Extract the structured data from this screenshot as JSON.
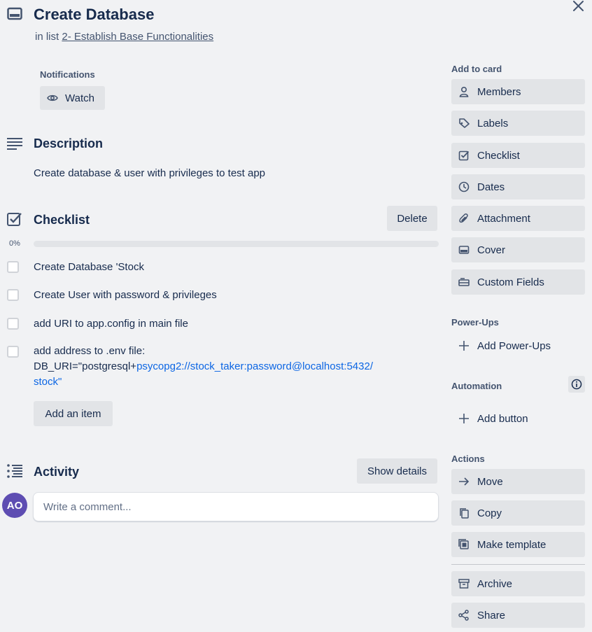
{
  "card": {
    "title": "Create Database",
    "in_list_prefix": "in list",
    "list_name": "2- Establish Base Functionalities"
  },
  "notifications": {
    "label": "Notifications",
    "watch_label": "Watch"
  },
  "description": {
    "heading": "Description",
    "text": "Create database & user with privileges to test app"
  },
  "checklist": {
    "heading": "Checklist",
    "delete_label": "Delete",
    "progress_percent": 0,
    "progress_label": "0%",
    "items": [
      {
        "text": "Create Database 'Stock",
        "checked": false
      },
      {
        "text": "Create User with password & privileges",
        "checked": false
      },
      {
        "text": "add URI to app.config in main file",
        "checked": false
      },
      {
        "text_line1": "add address to .env file:",
        "text_prefix": "DB_URI=\"postgresql+",
        "text_link": "psycopg2://stock_taker:password@localhost:5432/stock",
        "text_suffix": "\"",
        "checked": false
      }
    ],
    "add_item_label": "Add an item"
  },
  "activity": {
    "heading": "Activity",
    "show_details_label": "Show details",
    "avatar_initials": "AO",
    "comment_placeholder": "Write a comment..."
  },
  "sidebar": {
    "add_to_card_label": "Add to card",
    "add_to_card": [
      {
        "label": "Members",
        "icon": "person-icon"
      },
      {
        "label": "Labels",
        "icon": "tag-icon"
      },
      {
        "label": "Checklist",
        "icon": "checkbox-icon"
      },
      {
        "label": "Dates",
        "icon": "clock-icon"
      },
      {
        "label": "Attachment",
        "icon": "paperclip-icon"
      },
      {
        "label": "Cover",
        "icon": "cover-icon"
      },
      {
        "label": "Custom Fields",
        "icon": "custom-fields-icon"
      }
    ],
    "powerups_label": "Power-Ups",
    "add_powerups_label": "Add Power-Ups",
    "automation_label": "Automation",
    "add_button_label": "Add button",
    "actions_label": "Actions",
    "actions": [
      {
        "label": "Move",
        "icon": "arrow-right-icon"
      },
      {
        "label": "Copy",
        "icon": "copy-icon"
      },
      {
        "label": "Make template",
        "icon": "template-icon"
      },
      {
        "label": "Archive",
        "icon": "archive-icon"
      },
      {
        "label": "Share",
        "icon": "share-icon"
      }
    ]
  },
  "colors": {
    "background": "#f1f2f4",
    "button": "#e2e4e7",
    "text": "#172b4d",
    "link": "#0c66e4",
    "avatar": "#5e4db2"
  }
}
